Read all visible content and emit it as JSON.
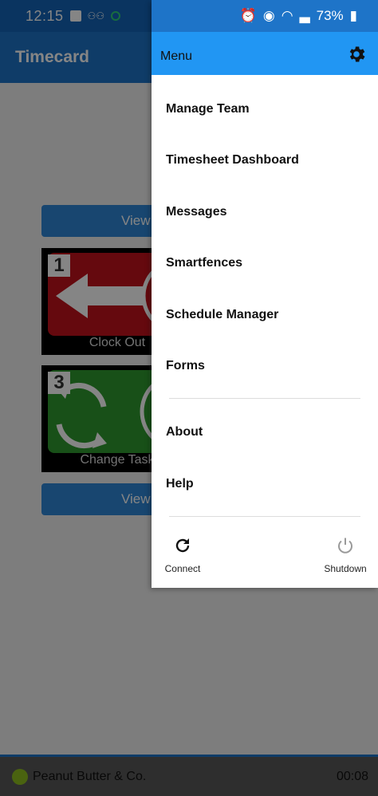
{
  "status": {
    "time": "12:15",
    "battery": "73%"
  },
  "app": {
    "title": "Timecard"
  },
  "buttons": {
    "view_top": "View",
    "view_bottom": "View"
  },
  "tiles": [
    {
      "number": "1",
      "label": "Clock Out"
    },
    {
      "number": "3",
      "label": "Change Task"
    }
  ],
  "drawer": {
    "title": "Menu",
    "items": [
      {
        "label": "Manage Team"
      },
      {
        "label": "Timesheet Dashboard"
      },
      {
        "label": "Messages"
      },
      {
        "label": "Smartfences"
      },
      {
        "label": "Schedule Manager"
      },
      {
        "label": "Forms"
      },
      {
        "label": "About"
      },
      {
        "label": "Help"
      }
    ],
    "connect_label": "Connect",
    "shutdown_label": "Shutdown"
  },
  "bottom": {
    "company": "Peanut Butter & Co.",
    "timer": "00:08"
  },
  "colors": {
    "primary": "#1e74c8",
    "header": "#2196f3",
    "red_tile": "#c1121b",
    "green_tile": "#2e9a2e"
  }
}
